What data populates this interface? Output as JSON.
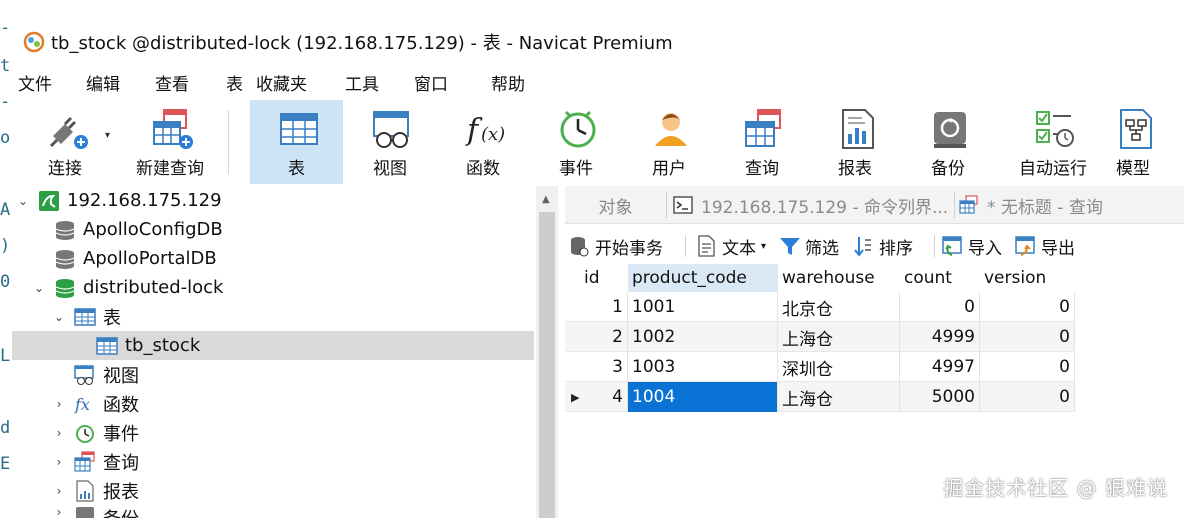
{
  "window": {
    "title": "tb_stock @distributed-lock (192.168.175.129) - 表 - Navicat Premium"
  },
  "edge_chars": [
    "-",
    "t",
    "-",
    "o",
    "A",
    ")",
    "0",
    "L",
    "d",
    "E"
  ],
  "menu": [
    "文件",
    "编辑",
    "查看",
    "表",
    "收藏夹",
    "工具",
    "窗口",
    "帮助"
  ],
  "toolbar": [
    {
      "label": "连接",
      "icon": "connect-plug-icon"
    },
    {
      "label": "新建查询",
      "icon": "new-query-icon"
    },
    {
      "label": "表",
      "icon": "table-icon",
      "active": true
    },
    {
      "label": "视图",
      "icon": "view-glasses-icon"
    },
    {
      "label": "函数",
      "icon": "function-fx-icon"
    },
    {
      "label": "事件",
      "icon": "event-clock-icon"
    },
    {
      "label": "用户",
      "icon": "user-icon"
    },
    {
      "label": "查询",
      "icon": "query-icon"
    },
    {
      "label": "报表",
      "icon": "report-icon"
    },
    {
      "label": "备份",
      "icon": "backup-icon"
    },
    {
      "label": "自动运行",
      "icon": "automation-icon"
    },
    {
      "label": "模型",
      "icon": "model-icon"
    }
  ],
  "tree": {
    "connection": "192.168.175.129",
    "db1": "ApolloConfigDB",
    "db2": "ApolloPortalDB",
    "db3": "distributed-lock",
    "tables_folder": "表",
    "table": "tb_stock",
    "views": "视图",
    "functions": "函数",
    "events": "事件",
    "queries": "查询",
    "reports": "报表",
    "backups": "备份"
  },
  "tabs": [
    "对象",
    "192.168.175.129 - 命令列界...",
    "* 无标题 - 查询"
  ],
  "grid_toolbar": {
    "begin_tx": "开始事务",
    "text": "文本",
    "filter": "筛选",
    "sort": "排序",
    "import": "导入",
    "export": "导出"
  },
  "grid": {
    "columns": [
      "id",
      "product_code",
      "warehouse",
      "count",
      "version"
    ],
    "rows": [
      [
        "1",
        "1001",
        "北京仓",
        "0",
        "0"
      ],
      [
        "2",
        "1002",
        "上海仓",
        "4999",
        "0"
      ],
      [
        "3",
        "1003",
        "深圳仓",
        "4997",
        "0"
      ],
      [
        "4",
        "1004",
        "上海仓",
        "5000",
        "0"
      ]
    ]
  },
  "watermark": "掘金技术社区 @ 狠难说",
  "colors": {
    "accent": "#0a72d4",
    "active_tool": "#cde4f7",
    "selected_tree": "#d9d9d9"
  }
}
